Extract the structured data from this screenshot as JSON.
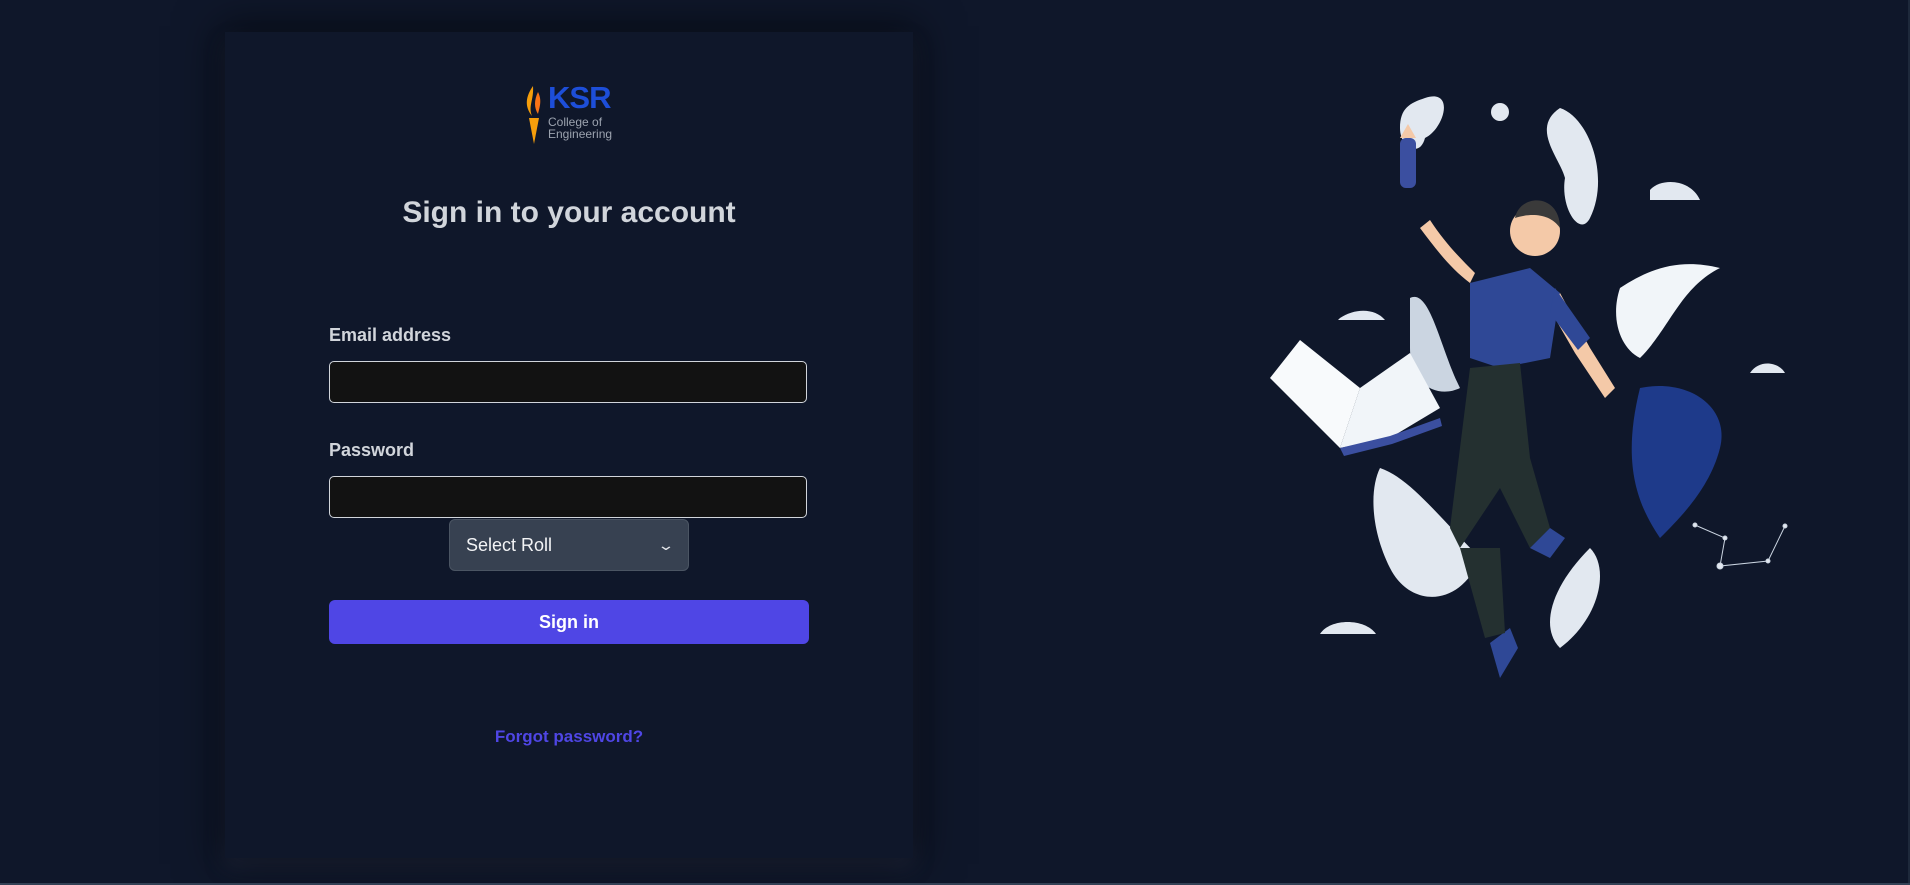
{
  "logo": {
    "brand": "KSR",
    "line1": "College of",
    "line2": "Engineering"
  },
  "form": {
    "title": "Sign in to your account",
    "email_label": "Email address",
    "email_value": "",
    "password_label": "Password",
    "password_value": "",
    "role_select_value": "Select Roll",
    "signin_label": "Sign in",
    "forgot_label": "Forgot password?"
  },
  "colors": {
    "background": "#0f172a",
    "accent": "#4f46e5",
    "brand": "#1d4ed8"
  },
  "illustration": {
    "icon": "person-floating-with-book-illustration"
  }
}
